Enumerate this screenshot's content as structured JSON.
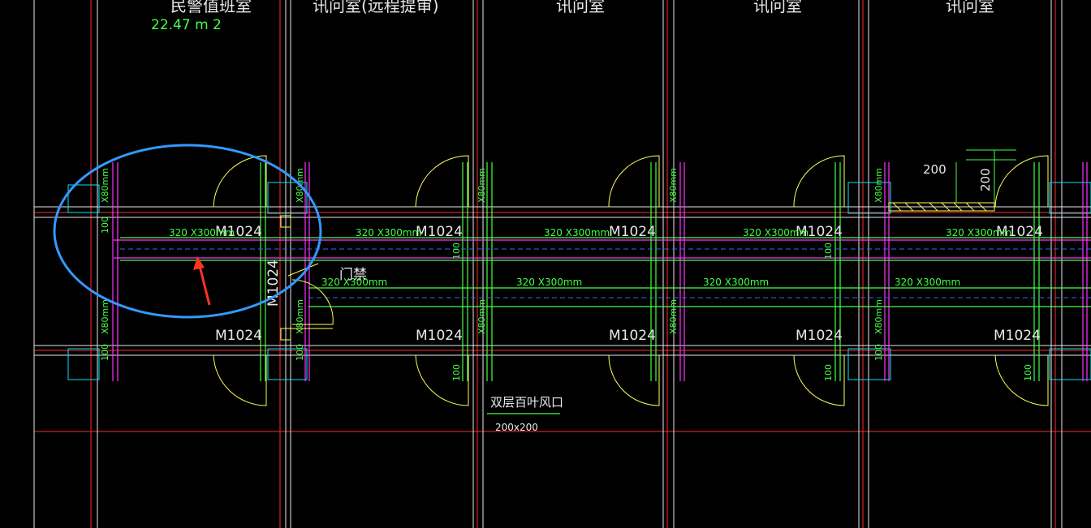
{
  "rooms": [
    {
      "label": "民警值班室",
      "area": "22.47 m 2"
    },
    {
      "label": "讯问室(远程提审)"
    },
    {
      "label": "讯问室"
    },
    {
      "label": "讯问室"
    },
    {
      "label": "讯问室"
    }
  ],
  "door_code": "M1024",
  "door_code_vertical": "M1024",
  "duct_label": "320  X300mm",
  "dim_100": "100",
  "dim_x80": "X80mm",
  "access_control": "门禁",
  "vent_label": "双层百叶风口",
  "vent_size": "200x200",
  "dim_200a": "200",
  "dim_200b": "200",
  "colors": {
    "background": "#000000",
    "grid_red": "#ff2a2a",
    "wall_white": "#e8e8e8",
    "duct_magenta": "#ff33ff",
    "duct_cyan": "#00e5ff",
    "door_yellow": "#ffff55",
    "text_green": "#44ff44",
    "annotation_blue": "#3399ff",
    "arrow_red": "#ff3322"
  }
}
